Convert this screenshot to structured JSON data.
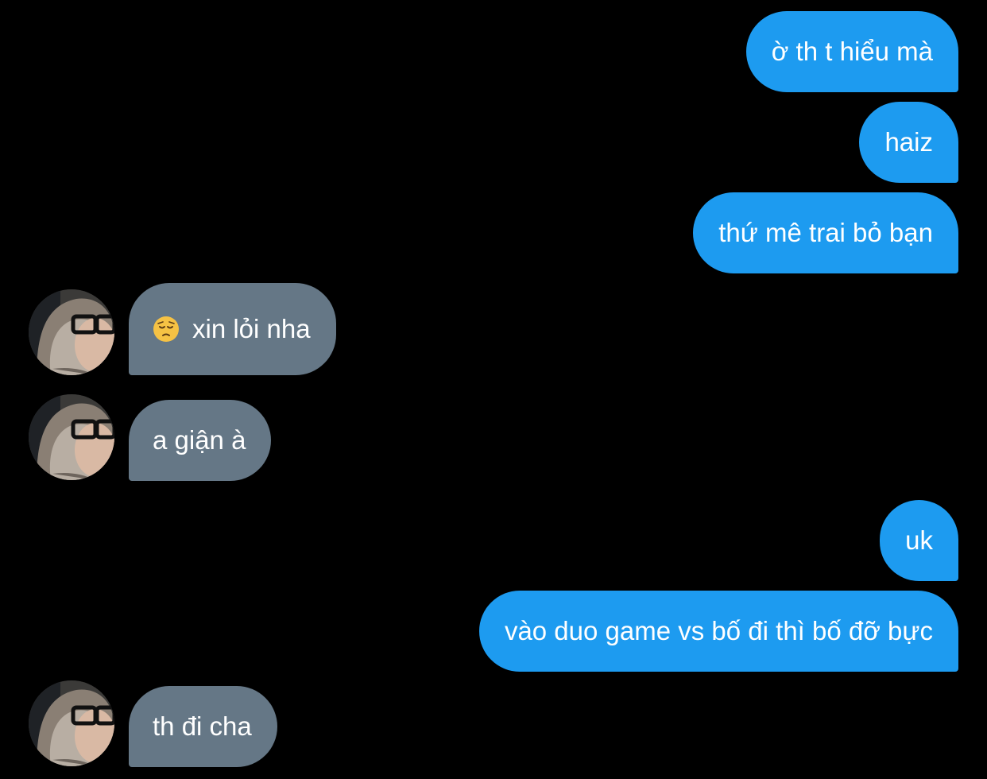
{
  "conversation": {
    "messages": [
      {
        "direction": "outgoing",
        "text": "ờ th t hiểu mà"
      },
      {
        "direction": "outgoing",
        "text": "haiz"
      },
      {
        "direction": "outgoing",
        "text": "thứ mê trai bỏ bạn"
      },
      {
        "direction": "incoming",
        "text": "xin lỏi nha",
        "emoji": "pensive-face-icon"
      },
      {
        "direction": "incoming",
        "text": "a giận à"
      },
      {
        "direction": "outgoing",
        "text": "uk"
      },
      {
        "direction": "outgoing",
        "text": "vào duo game vs bố đi thì bố đỡ bực"
      },
      {
        "direction": "incoming",
        "text": "th đi cha"
      }
    ]
  },
  "colors": {
    "background": "#000000",
    "outgoing_bubble": "#1d9bf0",
    "incoming_bubble": "#657786",
    "text": "#ffffff"
  }
}
